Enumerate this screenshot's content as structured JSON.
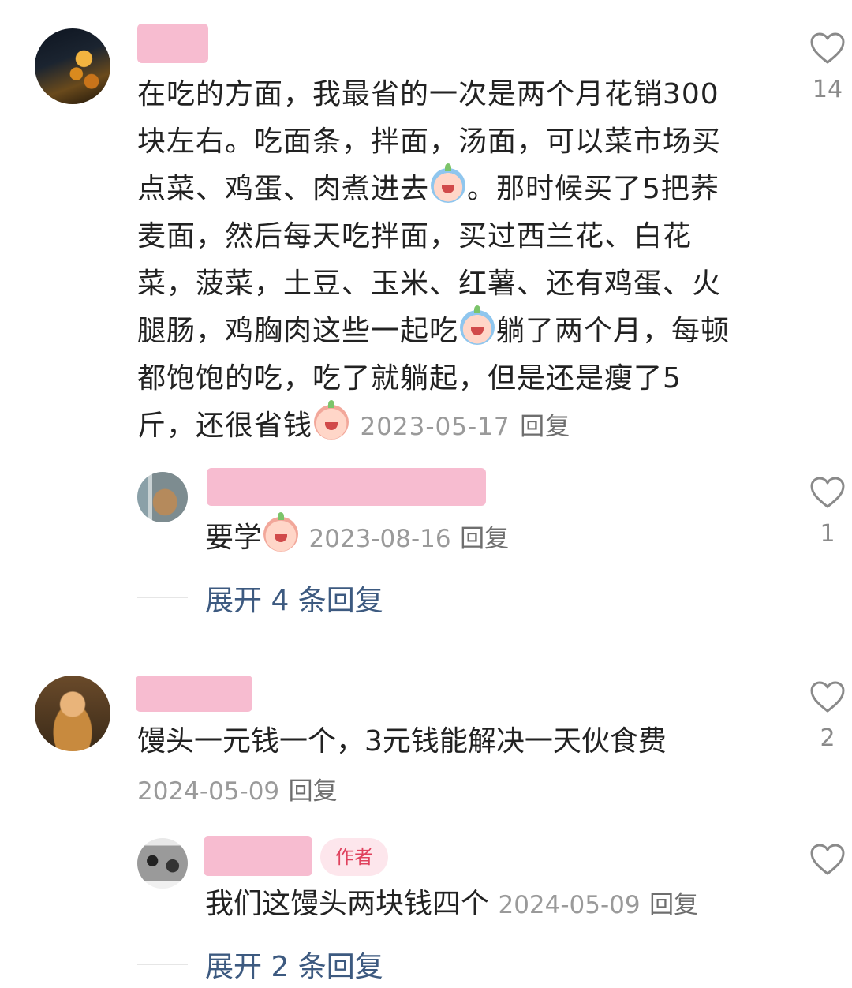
{
  "comments": [
    {
      "text_lines": [
        "在吃的方面，我最省的一次是两个月花销300",
        "块左右。吃面条，拌面，汤面，可以菜市场买",
        "点菜、鸡蛋、肉煮进去",
        "。那时候买了5把荞",
        "麦面，然后每天吃拌面，买过西兰花、白花",
        "菜，菠菜，土豆、玉米、红薯、还有鸡蛋、火",
        "腿肠，鸡胸肉这些一起吃",
        "躺了两个月，每顿",
        "都饱饱的吃，吃了就躺起，但是还是瘦了5",
        "斤，还很省钱"
      ],
      "date": "2023-05-17",
      "reply_label": "回复",
      "likes": "14",
      "reply": {
        "text": "要学",
        "date": "2023-08-16",
        "reply_label": "回复",
        "likes": "1"
      },
      "expand": "展开 4 条回复"
    },
    {
      "text": "馒头一元钱一个，3元钱能解决一天伙食费",
      "date": "2024-05-09",
      "reply_label": "回复",
      "likes": "2",
      "reply": {
        "badge": "作者",
        "text": "我们这馒头两块钱四个",
        "date": "2024-05-09",
        "reply_label": "回复",
        "likes": ""
      },
      "expand": "展开 2 条回复"
    }
  ],
  "icons": {
    "like": "heart-outline-icon",
    "emoji": "crying-peach-emoji"
  },
  "colors": {
    "name_mask": "#f7bcd0",
    "link": "#3d5a80",
    "meta": "#9a9a9a",
    "badge_text": "#e0425e",
    "badge_bg": "#fde6ec"
  }
}
